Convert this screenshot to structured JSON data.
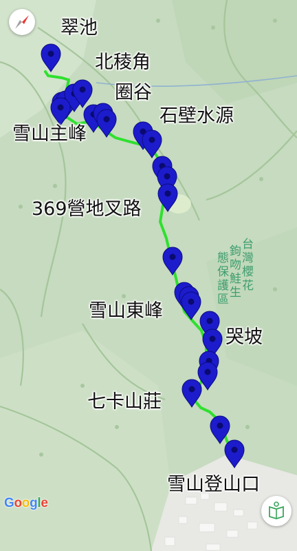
{
  "map": {
    "provider_logo": "Google",
    "park_name": "台灣櫻花鉤吻鮭生態保護區",
    "road_label": "台",
    "colors": {
      "route": "#2fe02f",
      "pin": "#1c1ccc",
      "background": "#c8dcc0",
      "compass_needle": "#e53935"
    }
  },
  "landmarks": [
    {
      "name": "翠池"
    },
    {
      "name": "北稜角"
    },
    {
      "name": "圈谷"
    },
    {
      "name": "石壁水源"
    },
    {
      "name": "雪山主峰"
    },
    {
      "name": "369營地叉路"
    },
    {
      "name": "雪山東峰"
    },
    {
      "name": "哭坡"
    },
    {
      "name": "七卡山莊"
    },
    {
      "name": "雪山登山口"
    }
  ],
  "pins_count": 22,
  "controls": {
    "compass_icon": "compass-icon",
    "map_book_icon": "map-book-icon"
  }
}
